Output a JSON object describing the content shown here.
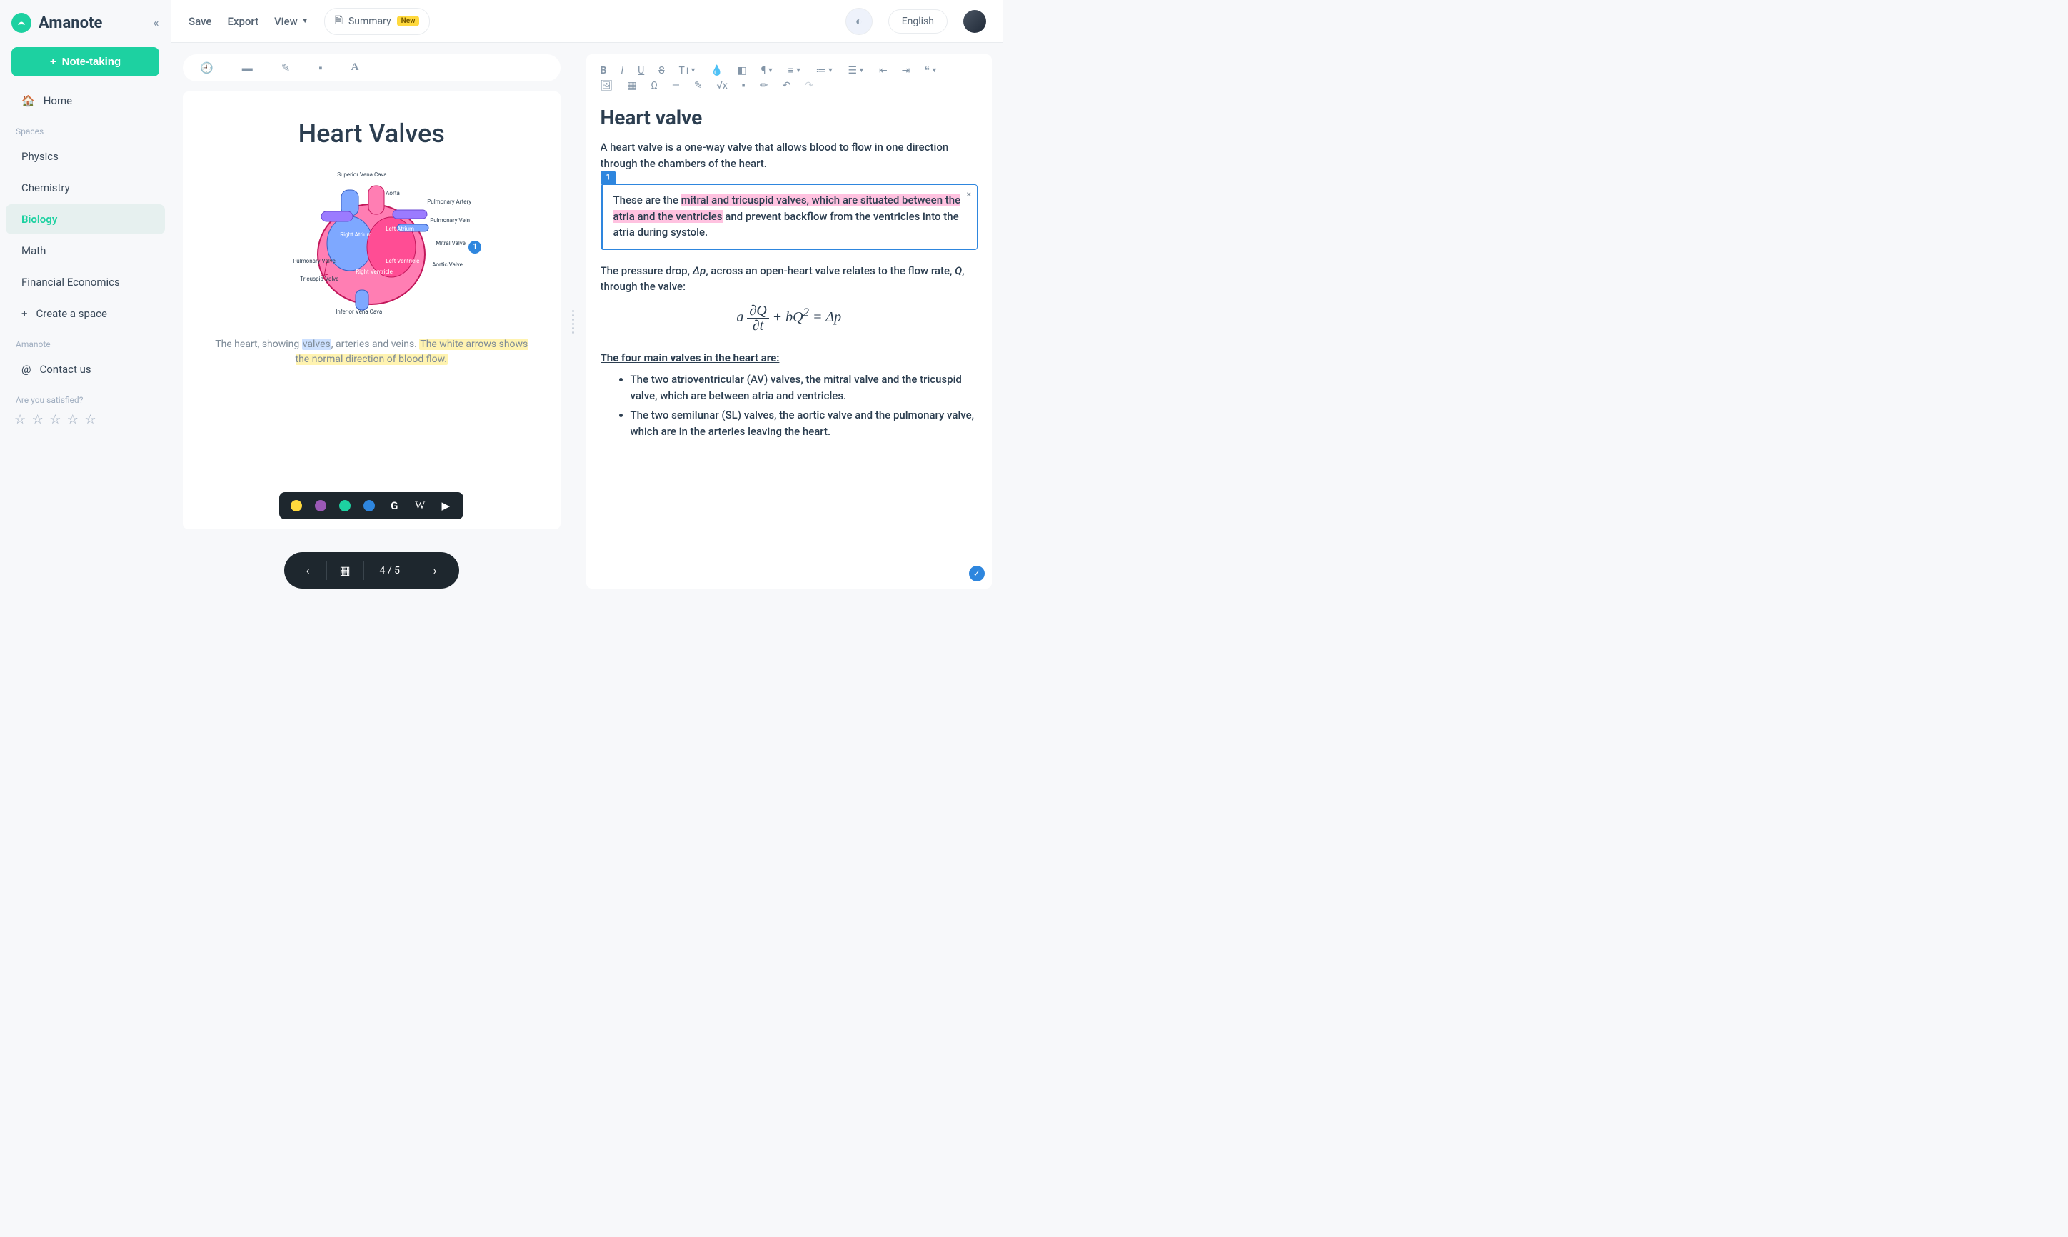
{
  "brand": "Amanote",
  "sidebar": {
    "primary_button": "Note-taking",
    "home": "Home",
    "spaces_label": "Spaces",
    "spaces": [
      "Physics",
      "Chemistry",
      "Biology",
      "Math",
      "Financial Economics"
    ],
    "active_space_index": 2,
    "create_space": "Create a space",
    "amanote_label": "Amanote",
    "contact": "Contact us",
    "satisfied": "Are you satisfied?"
  },
  "topbar": {
    "save": "Save",
    "export": "Export",
    "view": "View",
    "summary": "Summary",
    "new_badge": "New",
    "language": "English"
  },
  "slide": {
    "title": "Heart Valves",
    "caption_pre": "The heart, showing ",
    "caption_hl1": "valves",
    "caption_mid": ", arteries and veins. ",
    "caption_hl2": "The white arrows shows the normal direction of blood flow.",
    "marker": "1",
    "diagram_labels": {
      "svc": "Superior Vena Cava",
      "aorta": "Aorta",
      "pa": "Pulmonary Artery",
      "pv": "Pulmonary Vein",
      "mv": "Mitral Valve",
      "av": "Aortic Valve",
      "tv": "Tricuspid Valve",
      "ivc": "Inferior Vena Cava",
      "ra": "Right Atrium",
      "la": "Left Atrium",
      "lv": "Left Ventricle",
      "rv": "Right Ventricle",
      "pvalve": "Pulmonary Valve"
    },
    "popup_colors": [
      "#ffd93d",
      "#9b59b6",
      "#1dd1a1",
      "#2e86de"
    ],
    "pagination": "4 / 5"
  },
  "editor": {
    "h1": "Heart valve",
    "intro": "A heart valve is a one-way valve that allows blood to flow in one direction through the chambers of the heart.",
    "note_num": "1",
    "note_pre": "These are the ",
    "note_hl": "mitral and tricuspid valves, which are situated between the atria and the ventricles",
    "note_post": " and prevent backflow from the ventricles into the atria during systole.",
    "pressure_pre": "The pressure drop, ",
    "pressure_dp": "Δp",
    "pressure_mid": ", across an open-heart valve relates to the flow rate, ",
    "pressure_q": "Q",
    "pressure_post": ", through the valve:",
    "equation_html": "a (∂Q/∂t) + bQ² = Δp",
    "h4": "The four main valves in the heart are:",
    "li1": "The two atrioventricular (AV) valves, the mitral valve and the tricuspid valve, which are between atria and ventricles.",
    "li2": "The two semilunar (SL) valves, the aortic valve and the pulmonary valve, which are in the arteries leaving the heart."
  }
}
